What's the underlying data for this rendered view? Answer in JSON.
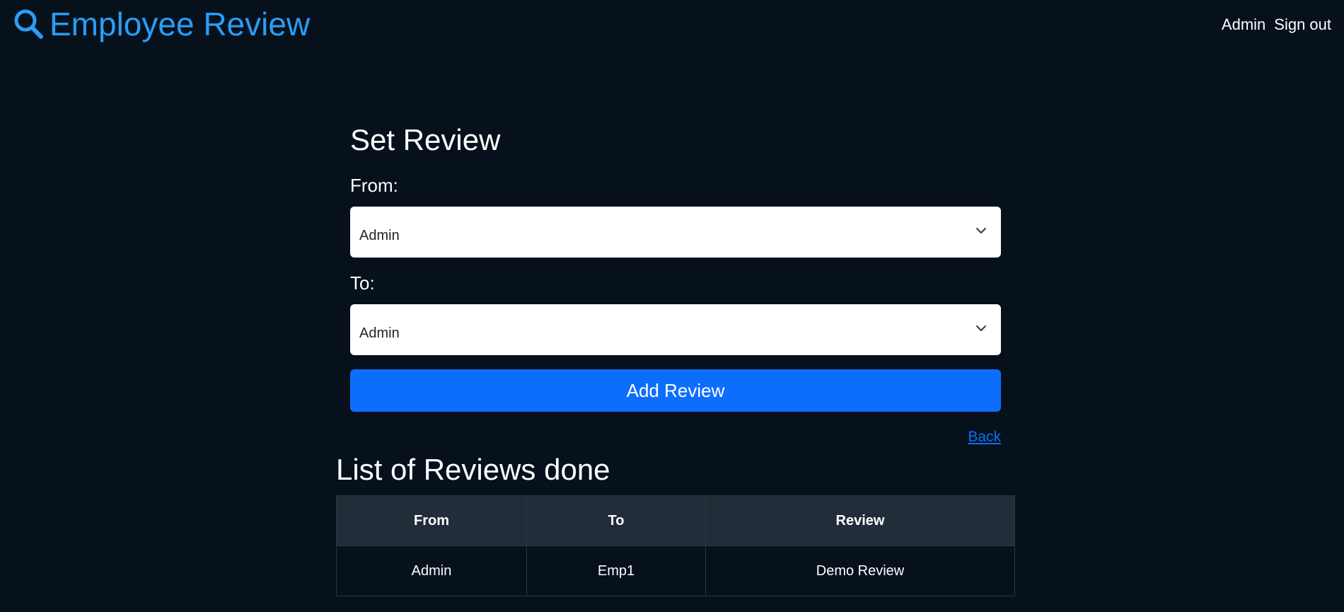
{
  "nav": {
    "brand": "Employee Review",
    "user": "Admin",
    "sign_out": "Sign out"
  },
  "form": {
    "title": "Set Review",
    "from_label": "From:",
    "from_value": "Admin",
    "to_label": "To:",
    "to_value": "Admin",
    "submit_label": "Add Review",
    "back_label": "Back"
  },
  "reviews": {
    "title": "List of Reviews done",
    "columns": [
      "From",
      "To",
      "Review"
    ],
    "rows": [
      [
        "Admin",
        "Emp1",
        "Demo Review"
      ]
    ]
  },
  "colors": {
    "background": "#06111c",
    "brand": "#2a9df4",
    "primary": "#0d6efd",
    "table_header": "#212d38"
  },
  "icons": {
    "brand": "search-icon",
    "select": "chevron-down-icon"
  }
}
